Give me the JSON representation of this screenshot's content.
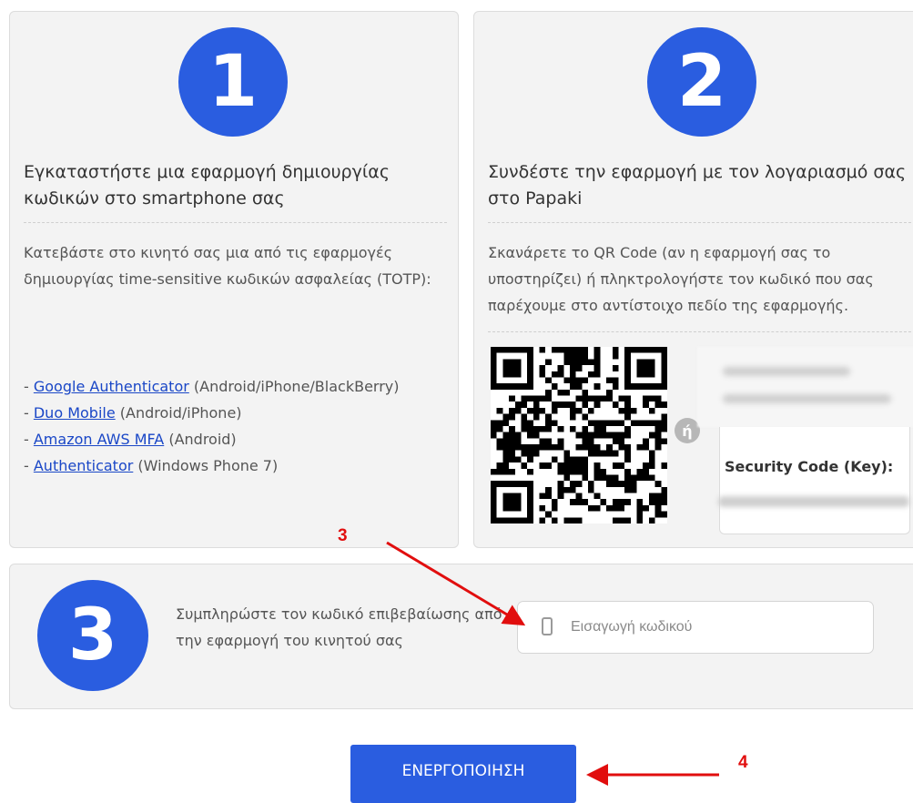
{
  "steps": [
    {
      "number": "1",
      "title": "Εγκαταστήστε μια εφαρμογή δημιουργίας κωδικών στο smartphone σας",
      "description": "Κατεβάστε στο κινητό σας μια από τις εφαρμογές δημιουργίας time-sensitive κωδικών ασφαλείας (TOTP):",
      "apps": [
        {
          "name": "Google Authenticator",
          "platforms": "(Android/iPhone/BlackBerry)"
        },
        {
          "name": "Duo Mobile",
          "platforms": "(Android/iPhone)"
        },
        {
          "name": "Amazon AWS MFA",
          "platforms": "(Android)"
        },
        {
          "name": "Authenticator",
          "platforms": "(Windows Phone 7)"
        }
      ]
    },
    {
      "number": "2",
      "title": "Συνδέστε την εφαρμογή με τον λογαριασμό σας στο Papaki",
      "description": "Σκανάρετε το QR Code (αν η εφαρμογή σας το υποστηρίζει) ή πληκτρολογήστε τον κωδικό που σας παρέχουμε στο αντίστοιχο πεδίο της εφαρμογής.",
      "or_label": "ή",
      "key_label": "Security Code (Key):"
    },
    {
      "number": "3",
      "title": "Συμπληρώστε τον κωδικό επιβεβαίωσης από την εφαρμογή του κινητού σας",
      "code_input": {
        "value": "",
        "placeholder": "Εισαγωγή κωδικού"
      }
    }
  ],
  "app_list_prefix": "- ",
  "activate_button": "ΕΝΕΡΓΟΠΟΙΗΣΗ",
  "annotations": {
    "label_3": "3",
    "label_4": "4",
    "color": "#e10e0e"
  },
  "colors": {
    "accent": "#2a5de0",
    "link": "#1a47c7",
    "card_bg": "#f3f3f3"
  },
  "icons": {
    "input_icon": "mobile-phone-icon",
    "qr": "qr-code"
  }
}
